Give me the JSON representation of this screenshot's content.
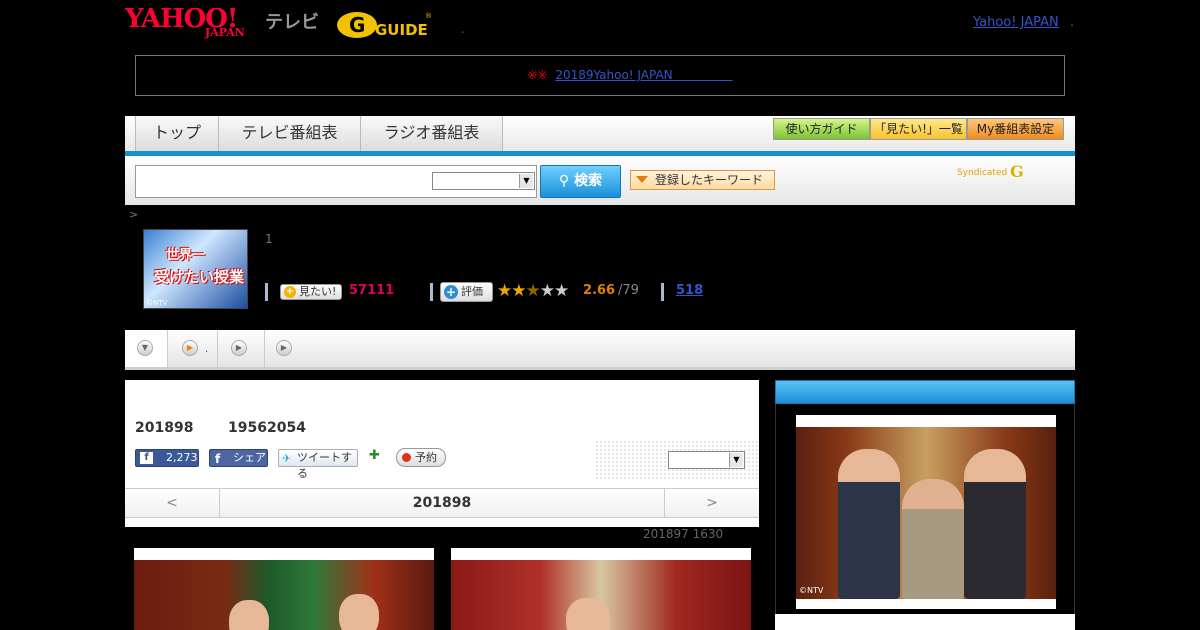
{
  "header": {
    "logo_yahoo": "YAHOO!",
    "logo_japan": "JAPAN",
    "logo_tv": "テレビ",
    "logo_gguide": "G GUIDE",
    "yahoo_link": "Yahoo! JAPAN",
    "dot": ".",
    "dot2": "."
  },
  "notice": {
    "marks": "※※",
    "link": "20189Yahoo! JAPAN　　　　　"
  },
  "nav": {
    "tabs": [
      "トップ",
      "テレビ番組表",
      "ラジオ番組表"
    ],
    "buttons": [
      "使い方ガイド",
      "「見たい!」一覧",
      "My番組表設定"
    ]
  },
  "search": {
    "button": "検索",
    "keyword_button": "登録したキーワード",
    "syndicated": "Syndicated",
    "synd_g": "G"
  },
  "breadcrumb": ">",
  "program": {
    "image_line1": "世界一",
    "image_line2": "受けたい授業",
    "image_credit": "©NTV",
    "number": "1",
    "mitai_label": "見たい!",
    "mitai_count": "57111",
    "hyoka_label": "評価",
    "stars_on": "★★",
    "stars_half": "★",
    "stars_off": "★★",
    "rating": "2.66",
    "rating_count": "/79",
    "review_count": "518"
  },
  "subtabs": {
    "dot": "."
  },
  "episode": {
    "date": "201898",
    "time": "19562054",
    "fb_count": "2,273",
    "share_label": "シェア",
    "tweet_label": "ツイートする",
    "yoyaku_label": "予約",
    "pager_prev": "<",
    "pager_current": "201898",
    "pager_next": ">",
    "air_info": "201897  1630"
  },
  "side": {
    "photo_credit": "©NTV"
  },
  "colors": {
    "accent": "#1a8fcc",
    "brand_red": "#ff0033",
    "mitai_pink": "#e0005a",
    "rating_orange": "#e08000"
  }
}
